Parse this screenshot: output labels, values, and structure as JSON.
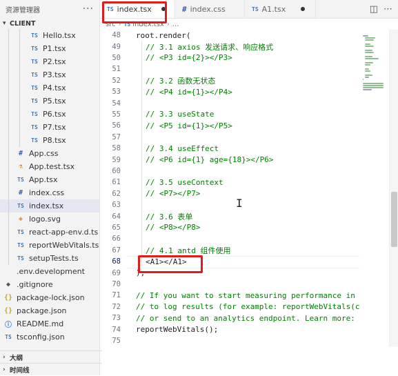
{
  "sidebar": {
    "title": "资源管理器",
    "more": "···",
    "section": "CLIENT",
    "items": [
      {
        "label": "Hello.tsx",
        "icon": "TS",
        "icon_name": "typescript-file-icon",
        "indent": 2
      },
      {
        "label": "P1.tsx",
        "icon": "TS",
        "icon_name": "typescript-file-icon",
        "indent": 2
      },
      {
        "label": "P2.tsx",
        "icon": "TS",
        "icon_name": "typescript-file-icon",
        "indent": 2
      },
      {
        "label": "P3.tsx",
        "icon": "TS",
        "icon_name": "typescript-file-icon",
        "indent": 2
      },
      {
        "label": "P4.tsx",
        "icon": "TS",
        "icon_name": "typescript-file-icon",
        "indent": 2
      },
      {
        "label": "P5.tsx",
        "icon": "TS",
        "icon_name": "typescript-file-icon",
        "indent": 2
      },
      {
        "label": "P6.tsx",
        "icon": "TS",
        "icon_name": "typescript-file-icon",
        "indent": 2
      },
      {
        "label": "P7.tsx",
        "icon": "TS",
        "icon_name": "typescript-file-icon",
        "indent": 2
      },
      {
        "label": "P8.tsx",
        "icon": "TS",
        "icon_name": "typescript-file-icon",
        "indent": 2
      },
      {
        "label": "App.css",
        "icon": "#",
        "icon_name": "css-file-icon",
        "indent": 1
      },
      {
        "label": "App.test.tsx",
        "icon": "⚗",
        "icon_name": "test-file-icon",
        "indent": 1
      },
      {
        "label": "App.tsx",
        "icon": "TS",
        "icon_name": "typescript-file-icon",
        "indent": 1
      },
      {
        "label": "index.css",
        "icon": "#",
        "icon_name": "css-file-icon",
        "indent": 1
      },
      {
        "label": "index.tsx",
        "icon": "TS",
        "icon_name": "typescript-file-icon",
        "indent": 1,
        "selected": true
      },
      {
        "label": "logo.svg",
        "icon": "◈",
        "icon_name": "svg-file-icon",
        "indent": 1
      },
      {
        "label": "react-app-env.d.ts",
        "icon": "TS",
        "icon_name": "typescript-file-icon",
        "indent": 1
      },
      {
        "label": "reportWebVitals.ts",
        "icon": "TS",
        "icon_name": "typescript-file-icon",
        "indent": 1
      },
      {
        "label": "setupTests.ts",
        "icon": "TS",
        "icon_name": "typescript-file-icon",
        "indent": 1
      },
      {
        "label": ".env.development",
        "icon": "",
        "icon_name": "env-file-icon",
        "indent": 0
      },
      {
        "label": ".gitignore",
        "icon": "◆",
        "icon_name": "git-file-icon",
        "indent": 0
      },
      {
        "label": "package-lock.json",
        "icon": "{}",
        "icon_name": "json-file-icon",
        "indent": 0
      },
      {
        "label": "package.json",
        "icon": "{}",
        "icon_name": "json-file-icon",
        "indent": 0
      },
      {
        "label": "README.md",
        "icon": "ⓘ",
        "icon_name": "info-file-icon",
        "indent": 0
      },
      {
        "label": "tsconfig.json",
        "icon": "TS",
        "icon_name": "typescript-file-icon",
        "indent": 0
      }
    ],
    "outline": "大纲",
    "timeline": "时间线"
  },
  "tabs": [
    {
      "label": "index.tsx",
      "icon": "TS",
      "active": true,
      "dirty": true
    },
    {
      "label": "index.css",
      "icon": "#",
      "active": false,
      "dirty": false
    },
    {
      "label": "A1.tsx",
      "icon": "TS",
      "active": false,
      "dirty": true
    }
  ],
  "breadcrumb": {
    "folder": "src",
    "file_icon": "TS",
    "file": "index.tsx",
    "more": "..."
  },
  "editor": {
    "current_line": 68,
    "lines": [
      {
        "n": 48,
        "text": "root.render(",
        "kind": "plain",
        "indent": 0
      },
      {
        "n": 49,
        "text": "// 3.1 axios 发送请求、响应格式",
        "kind": "comment",
        "indent": 1
      },
      {
        "n": 50,
        "text": "// <P3 id={2}></P3>",
        "kind": "comment",
        "indent": 1
      },
      {
        "n": 51,
        "text": "",
        "kind": "plain",
        "indent": 1
      },
      {
        "n": 52,
        "text": "// 3.2 函数无状态",
        "kind": "comment",
        "indent": 1
      },
      {
        "n": 53,
        "text": "// <P4 id={1}></P4>",
        "kind": "comment",
        "indent": 1
      },
      {
        "n": 54,
        "text": "",
        "kind": "plain",
        "indent": 1
      },
      {
        "n": 55,
        "text": "// 3.3 useState",
        "kind": "comment",
        "indent": 1
      },
      {
        "n": 56,
        "text": "// <P5 id={1}></P5>",
        "kind": "comment",
        "indent": 1
      },
      {
        "n": 57,
        "text": "",
        "kind": "plain",
        "indent": 1
      },
      {
        "n": 58,
        "text": "// 3.4 useEffect",
        "kind": "comment",
        "indent": 1
      },
      {
        "n": 59,
        "text": "// <P6 id={1} age={18}></P6>",
        "kind": "comment",
        "indent": 1
      },
      {
        "n": 60,
        "text": "",
        "kind": "plain",
        "indent": 1
      },
      {
        "n": 61,
        "text": "// 3.5 useContext",
        "kind": "comment",
        "indent": 1
      },
      {
        "n": 62,
        "text": "// <P7></P7>",
        "kind": "comment",
        "indent": 1
      },
      {
        "n": 63,
        "text": "",
        "kind": "plain",
        "indent": 1
      },
      {
        "n": 64,
        "text": "// 3.6 表单",
        "kind": "comment",
        "indent": 1
      },
      {
        "n": 65,
        "text": "// <P8></P8>",
        "kind": "comment",
        "indent": 1
      },
      {
        "n": 66,
        "text": "",
        "kind": "plain",
        "indent": 1
      },
      {
        "n": 67,
        "text": "// 4.1 antd 组件使用",
        "kind": "comment",
        "indent": 1
      },
      {
        "n": 68,
        "text": "<A1></A1>",
        "kind": "plain",
        "indent": 1
      },
      {
        "n": 69,
        "text": ");",
        "kind": "plain",
        "indent": 0
      },
      {
        "n": 70,
        "text": "",
        "kind": "plain",
        "indent": 0
      },
      {
        "n": 71,
        "text": "// If you want to start measuring performance in",
        "kind": "comment",
        "indent": 0
      },
      {
        "n": 72,
        "text": "// to log results (for example: reportWebVitals(c",
        "kind": "comment",
        "indent": 0
      },
      {
        "n": 73,
        "text": "// or send to an analytics endpoint. Learn more:",
        "kind": "comment",
        "indent": 0
      },
      {
        "n": 74,
        "text": "reportWebVitals();",
        "kind": "plain",
        "indent": 0
      },
      {
        "n": 75,
        "text": "",
        "kind": "plain",
        "indent": 0
      }
    ]
  },
  "colors": {
    "annotation": "#e11b1b",
    "comment": "#008000",
    "ts": "#3178c6"
  }
}
